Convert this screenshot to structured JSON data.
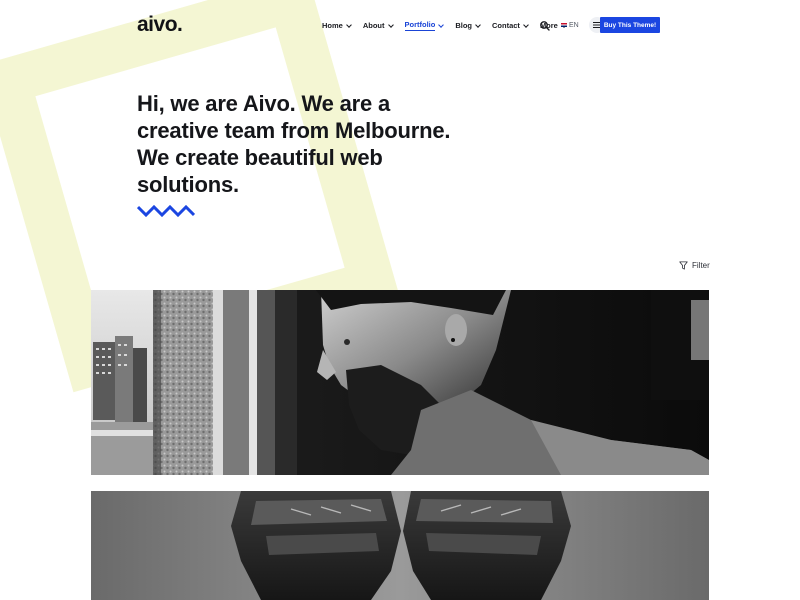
{
  "brand": {
    "logo_text": "aivo."
  },
  "nav": {
    "items": [
      {
        "label": "Home"
      },
      {
        "label": "About"
      },
      {
        "label": "Portfolio",
        "active": true
      },
      {
        "label": "Blog"
      },
      {
        "label": "Contact"
      },
      {
        "label": "More"
      }
    ]
  },
  "header_tools": {
    "language": "EN",
    "buy_label": "Buy This Theme!"
  },
  "hero": {
    "lines": [
      "Hi, we are Aivo. We are a",
      "creative team from Melbourne.",
      "We create beautiful web",
      "solutions."
    ]
  },
  "portfolio": {
    "filter_label": "Filter",
    "items": [
      {
        "image": "man-portrait-window"
      },
      {
        "image": "boxing-gloves"
      }
    ]
  },
  "colors": {
    "accent": "#1b46e1",
    "deco_square": "#f4f6d3",
    "text": "#15161a"
  },
  "icons": {
    "search": "search-icon",
    "menu": "hamburger-icon",
    "filter": "filter-icon",
    "caret": "chevron-down-icon"
  }
}
